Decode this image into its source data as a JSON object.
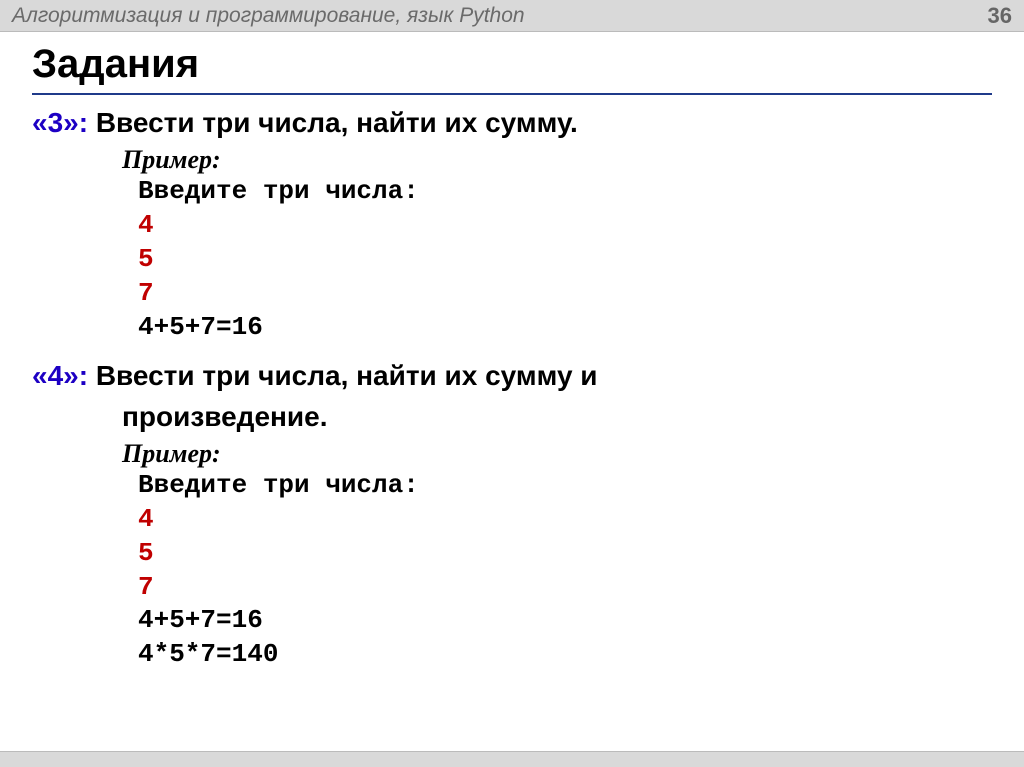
{
  "header": {
    "title": "Алгоритмизация и программирование, язык Python",
    "page": "36"
  },
  "heading": "Задания",
  "task1": {
    "grade": "«3»:",
    "text": "Ввести три числа, найти их сумму.",
    "example_label": "Пример:",
    "code": {
      "prompt": "Введите три числа:",
      "l1": "4",
      "l2": "5",
      "l3": "7",
      "result1": "4+5+7=16"
    }
  },
  "task2": {
    "grade": "«4»:",
    "text1": "Ввести три числа, найти их сумму и",
    "text2": "произведение.",
    "example_label": "Пример:",
    "code": {
      "prompt": "Введите три числа:",
      "l1": "4",
      "l2": "5",
      "l3": "7",
      "result1": "4+5+7=16",
      "result2": "4*5*7=140"
    }
  }
}
